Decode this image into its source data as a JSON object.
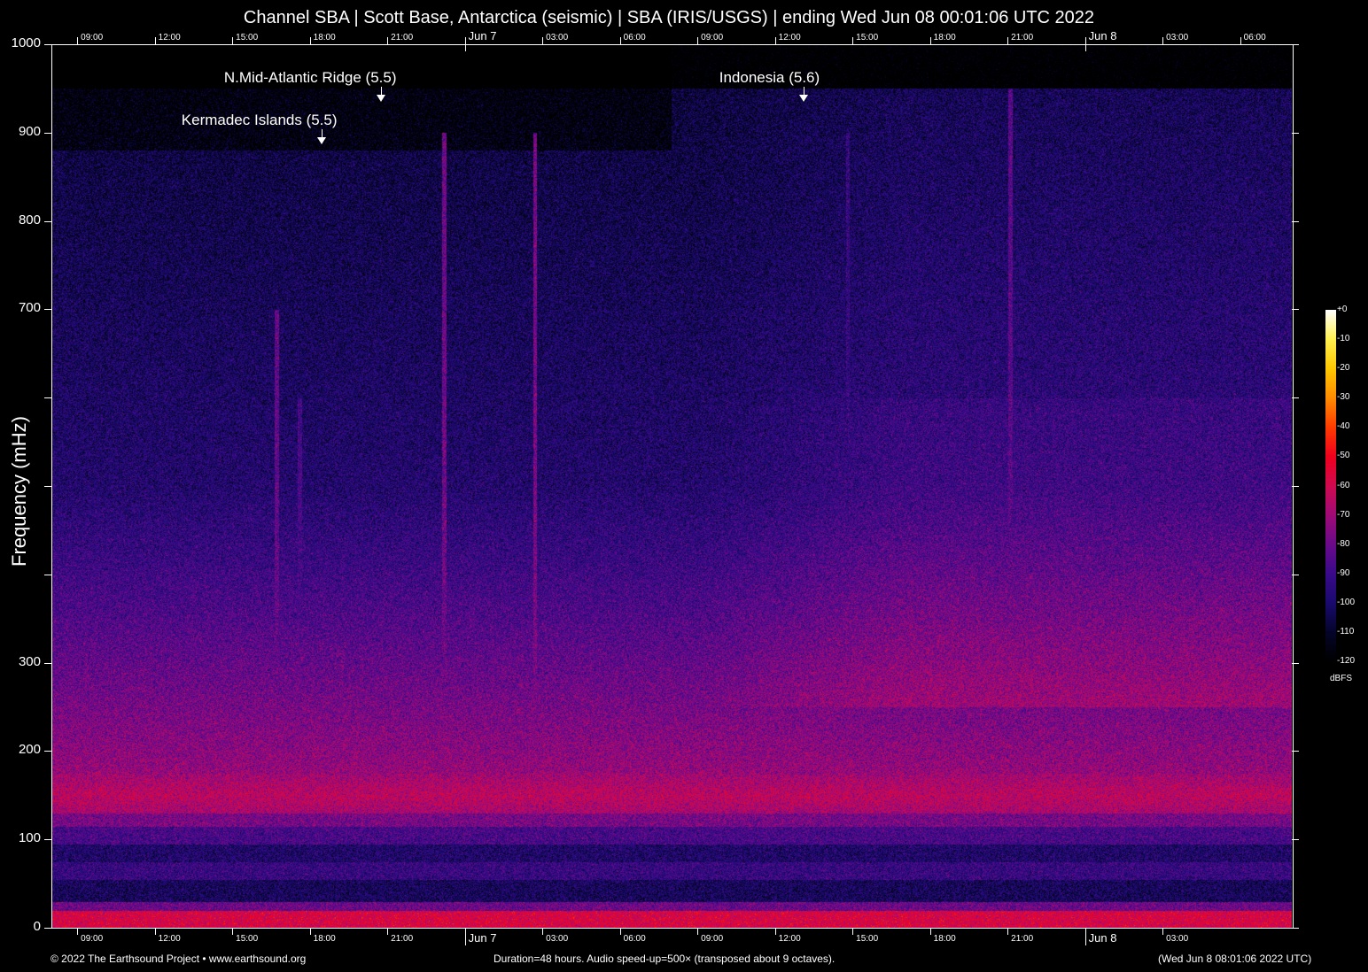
{
  "chart_data": {
    "type": "heatmap",
    "title": "Channel SBA | Scott Base, Antarctica (seismic) | SBA (IRIS/USGS) | ending Wed Jun 08 00:01:06 UTC 2022",
    "ylabel": "Frequency (mHz)",
    "ylim": [
      0,
      1000
    ],
    "y_tick_labels": [
      "1000",
      "900",
      "800",
      "700",
      "300",
      "200",
      "100",
      "0"
    ],
    "y_tick_values": [
      1000,
      900,
      800,
      700,
      600,
      500,
      400,
      300,
      200,
      100,
      0
    ],
    "x_duration_hours": 48,
    "x_top_labels": [
      "09:00",
      "12:00",
      "15:00",
      "18:00",
      "21:00",
      "Jun  7",
      "03:00",
      "06:00",
      "09:00",
      "12:00",
      "15:00",
      "18:00",
      "21:00",
      "Jun  8",
      "03:00",
      "06:00"
    ],
    "x_bottom_labels": [
      "09:00",
      "12:00",
      "15:00",
      "18:00",
      "21:00",
      "Jun  7",
      "03:00",
      "06:00",
      "09:00",
      "12:00",
      "15:00",
      "18:00",
      "21:00",
      "Jun  8",
      "03:00"
    ],
    "x_label_hours": [
      1,
      4,
      7,
      10,
      13,
      16,
      19,
      22,
      25,
      28,
      31,
      34,
      37,
      40,
      43,
      46
    ],
    "colorbar": {
      "label": "dBFS",
      "ticks": [
        "+0",
        "-10",
        "-20",
        "-30",
        "-40",
        "-50",
        "-60",
        "-70",
        "-80",
        "-90",
        "-100",
        "-110",
        "-120"
      ],
      "range": [
        -120,
        0
      ],
      "stops": [
        "#000000",
        "#05052a",
        "#1a0a6e",
        "#3a0a8a",
        "#6a0a8a",
        "#a00a78",
        "#d00a50",
        "#f0001e",
        "#ff3c00",
        "#ff8c00",
        "#ffc800",
        "#fff050",
        "#ffffff"
      ]
    },
    "annotations": [
      {
        "text": "N.Mid-Atlantic Ridge (5.5)",
        "hour": 12.75,
        "freq_label": 960
      },
      {
        "text": "Kermadec Islands (5.5)",
        "hour": 10.45,
        "freq_label": 912
      },
      {
        "text": "Indonesia (5.6)",
        "hour": 29.1,
        "freq_label": 960
      }
    ]
  },
  "footer": {
    "copyright": "© 2022 The Earthsound Project • www.earthsound.org",
    "info": "Duration=48 hours. Audio speed-up=500× (transposed about 9 octaves).",
    "local_time": "(Wed Jun  8 08:01:06 2022 UTC)"
  }
}
